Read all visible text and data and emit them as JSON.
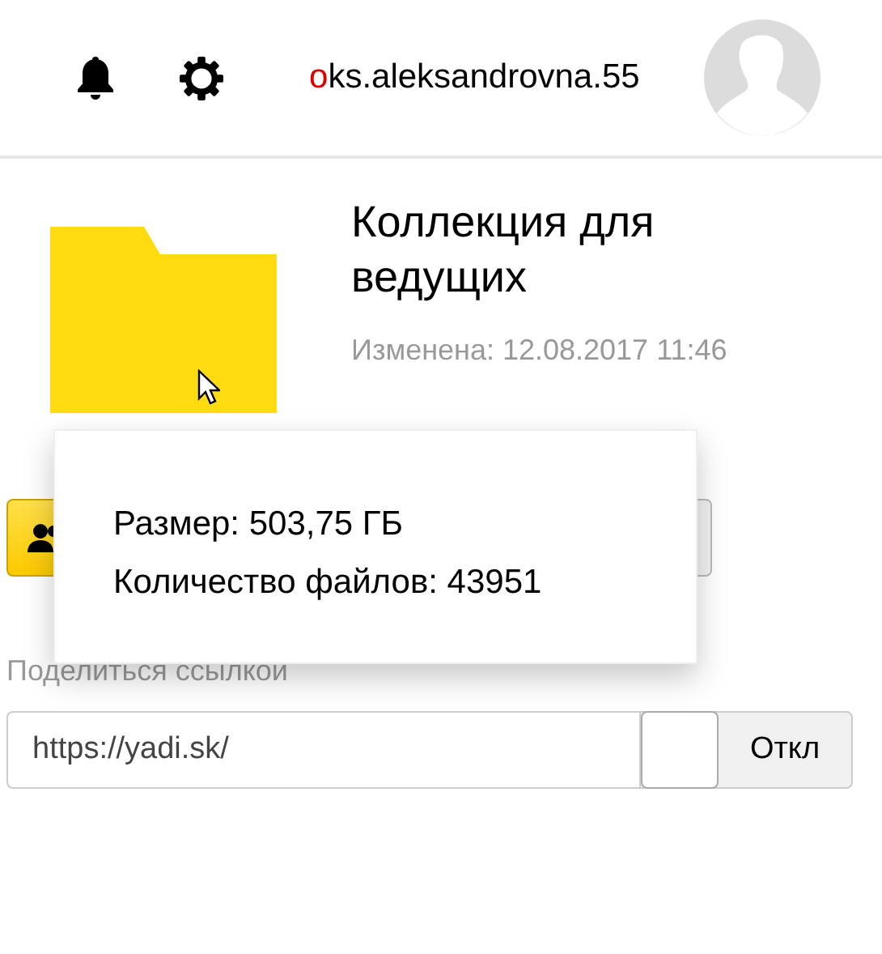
{
  "header": {
    "username_first": "o",
    "username_rest": "ks.aleksandrovna.55"
  },
  "folder": {
    "title": "Коллекция для ведущих",
    "modified": "Изменена: 12.08.2017 11:46"
  },
  "popup": {
    "lines": [
      "Размер: 503,75 ГБ",
      "Количество файлов: 43951"
    ]
  },
  "share": {
    "label": "Поделиться ссылкой",
    "link": "https://yadi.sk/",
    "toggle": {
      "on": false,
      "label": "Откл"
    }
  }
}
